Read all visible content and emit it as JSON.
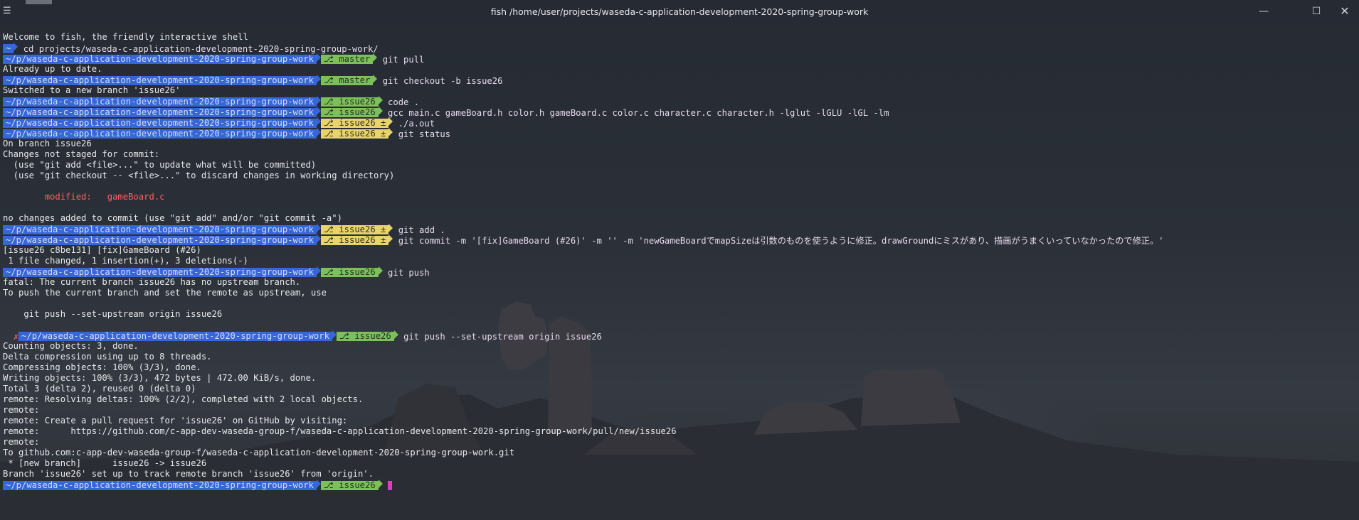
{
  "window": {
    "title": "fish /home/user/projects/waseda-c-application-development-2020-spring-group-work",
    "menu_icon": "hamburger-menu-icon",
    "controls": [
      "minimize-icon",
      "maximize-icon",
      "close-icon"
    ],
    "control_glyphs": {
      "minimize": "—",
      "maximize": "☐",
      "close": "✕"
    }
  },
  "prompt": {
    "path": "~/p/waseda-c-application-development-2020-spring-group-work",
    "colors": {
      "path": "#3567d9",
      "branch_clean": "#7cc05a",
      "branch_dirty": "#e8d46a",
      "cursor": "#e03bc8",
      "error": "#ff5f5f"
    }
  },
  "terminal": {
    "welcome": "Welcome to fish, the friendly interactive shell",
    "home_prompt": "~",
    "cmd_cd": "cd projects/waseda-c-application-development-2020-spring-group-work/",
    "branch_master": "master",
    "branch_issue26": "issue26",
    "branch_issue26_dirty": "issue26 ±",
    "cmd_pull": "git pull",
    "out_uptodate": "Already up to date.",
    "cmd_checkout": "git checkout -b issue26",
    "out_switched": "Switched to a new branch 'issue26'",
    "cmd_code": "code .",
    "cmd_gcc": "gcc main.c gameBoard.h color.h gameBoard.c color.c character.c character.h -lglut -lGLU -lGL -lm",
    "cmd_run": "./a.out",
    "cmd_status": "git status",
    "out_onbranch": "On branch issue26",
    "out_notstaged": "Changes not staged for commit:",
    "out_hint1": "  (use \"git add <file>...\" to update what will be committed)",
    "out_hint2": "  (use \"git checkout -- <file>...\" to discard changes in working directory)",
    "out_modified": "        modified:   gameBoard.c",
    "out_nochanges": "no changes added to commit (use \"git add\" and/or \"git commit -a\")",
    "cmd_add": "git add .",
    "cmd_commit": "git commit -m '[fix]GameBoard (#26)' -m '' -m 'newGameBoardでmapSizeは引数のものを使うように修正。drawGroundにミスがあり、描画がうまくいっていなかったので修正。'",
    "out_commit1": "[issue26 c8be131] [fix]GameBoard (#26)",
    "out_commit2": " 1 file changed, 1 insertion(+), 3 deletions(-)",
    "cmd_push": "git push",
    "out_fatal": "fatal: The current branch issue26 has no upstream branch.",
    "out_topush": "To push the current branch and set the remote as upstream, use",
    "out_suggest": "    git push --set-upstream origin issue26",
    "error_mark": "✗",
    "cmd_push_upstream": "git push --set-upstream origin issue26",
    "out_p1": "Counting objects: 3, done.",
    "out_p2": "Delta compression using up to 8 threads.",
    "out_p3": "Compressing objects: 100% (3/3), done.",
    "out_p4": "Writing objects: 100% (3/3), 472 bytes | 472.00 KiB/s, done.",
    "out_p5": "Total 3 (delta 2), reused 0 (delta 0)",
    "out_p6": "remote: Resolving deltas: 100% (2/2), completed with 2 local objects.",
    "out_p7": "remote:",
    "out_p8": "remote: Create a pull request for 'issue26' on GitHub by visiting:",
    "out_p9": "remote:      https://github.com/c-app-dev-waseda-group-f/waseda-c-application-development-2020-spring-group-work/pull/new/issue26",
    "out_p10": "remote:",
    "out_p11": "To github.com:c-app-dev-waseda-group-f/waseda-c-application-development-2020-spring-group-work.git",
    "out_p12": " * [new branch]      issue26 -> issue26",
    "out_p13": "Branch 'issue26' set up to track remote branch 'issue26' from 'origin'."
  }
}
